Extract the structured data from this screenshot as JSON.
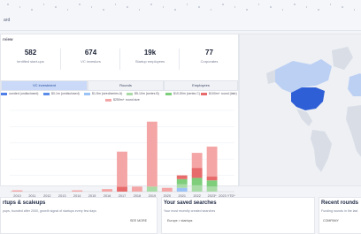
{
  "header": {
    "crumb": "ard"
  },
  "overview": {
    "title": "rview",
    "kpis": [
      {
        "value": "582",
        "label": "lentified start-ups"
      },
      {
        "value": "674",
        "label": "VC investors"
      },
      {
        "value": "19k",
        "label": "Startup employees"
      },
      {
        "value": "77",
        "label": "Corporates"
      }
    ]
  },
  "tabs": [
    {
      "label": "VC investment"
    },
    {
      "label": "Rounds"
    },
    {
      "label": "Employees"
    }
  ],
  "legend": [
    {
      "label": "ounded (undisclosed)",
      "color": "#4f7fe6"
    },
    {
      "label": "$0-1m (undisclosed)",
      "color": "#5b8de8"
    },
    {
      "label": "$1-5m (seed/series A)",
      "color": "#9cc3f5"
    },
    {
      "label": "$5-10m (series B)",
      "color": "#a9dba6"
    },
    {
      "label": "$10-50m (series C)",
      "color": "#7fce7c"
    },
    {
      "label": "$50-100m (series D)",
      "color": "#c7e8c0"
    },
    {
      "label": "$100m+ round (late)",
      "color": "#e86b6b"
    },
    {
      "label": "$250m+ round size",
      "color": "#f4a5a5"
    }
  ],
  "chart_data": {
    "type": "bar",
    "categories": [
      "2010",
      "2011",
      "2012",
      "2013",
      "2014",
      "2015",
      "2016",
      "2017",
      "2018",
      "2019",
      "2020",
      "2021",
      "2022",
      "2023*",
      "2023 YTD*"
    ],
    "series": [
      {
        "name": "$1-5m (seed/series A)",
        "color": "#9cc3f5",
        "values": [
          0,
          0,
          0,
          0,
          0,
          0,
          0,
          0,
          0,
          0,
          0,
          0.3,
          0,
          0,
          0
        ]
      },
      {
        "name": "$5-10m (series B)",
        "color": "#a9dba6",
        "values": [
          0,
          0,
          0,
          0,
          0,
          0,
          0,
          0,
          0,
          0.4,
          0,
          0.3,
          0.5,
          0.4,
          0
        ]
      },
      {
        "name": "$10-50m (series C)",
        "color": "#7fce7c",
        "values": [
          0,
          0,
          0,
          0,
          0,
          0,
          0,
          0,
          0,
          0,
          0,
          0.4,
          0.6,
          0.5,
          0
        ]
      },
      {
        "name": "$100m+ round (late)",
        "color": "#e86b6b",
        "values": [
          0,
          0,
          0,
          0,
          0,
          0,
          0,
          0.4,
          0,
          0,
          0,
          0.3,
          0.8,
          0.3,
          0
        ]
      },
      {
        "name": "$250m+ round size",
        "color": "#f4a5a5",
        "values": [
          0.1,
          0,
          0,
          0,
          0.1,
          0,
          0.2,
          2.8,
          0.4,
          5.2,
          0.3,
          0,
          1.2,
          2.4,
          0
        ]
      }
    ],
    "xlabel": "View chart",
    "ylim": [
      0,
      6.5
    ],
    "grid": true
  },
  "cards": [
    {
      "title": "rtups & scaleups",
      "subtitle": "pups, founded after 2000, growth signal of startups every few days",
      "right": "SEE MORE"
    },
    {
      "title": "Your saved searches",
      "subtitle": "Your most recently created searches",
      "item": "Europe > startups"
    },
    {
      "title": "Recent rounds",
      "subtitle": "Funding rounds in the last",
      "item": "COMPANY"
    }
  ],
  "colors": {
    "map_land": "#d8dde6",
    "map_ocean": "#eef0f4",
    "map_us": "#2f5fd6",
    "map_light": "#bcd0f4"
  }
}
